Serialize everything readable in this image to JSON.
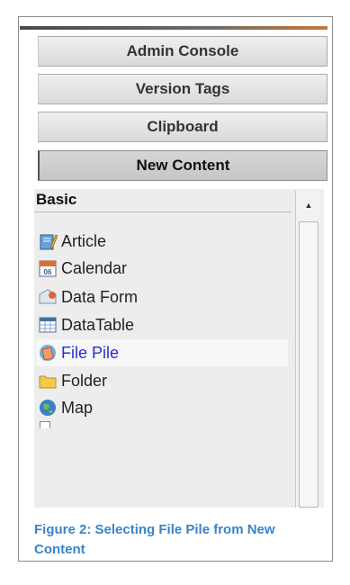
{
  "tabs": [
    {
      "label": "Admin Console"
    },
    {
      "label": "Version Tags"
    },
    {
      "label": "Clipboard"
    },
    {
      "label": "New Content"
    }
  ],
  "section": {
    "label": "Basic"
  },
  "items": [
    {
      "label": "Article",
      "icon": "article-icon"
    },
    {
      "label": "Calendar",
      "icon": "calendar-icon",
      "icon_text": "06"
    },
    {
      "label": "Data Form",
      "icon": "data-form-icon"
    },
    {
      "label": "DataTable",
      "icon": "datatable-icon"
    },
    {
      "label": "File Pile",
      "icon": "file-pile-icon"
    },
    {
      "label": "Folder",
      "icon": "folder-icon"
    },
    {
      "label": "Map",
      "icon": "map-icon"
    }
  ],
  "selected_item": "File Pile",
  "caption": {
    "text": "Figure 2: Selecting File Pile from New Content"
  },
  "colors": {
    "caption": "#3a83c8",
    "selected_text": "#2b2bd6",
    "topbar_accent": "#c77a3a"
  }
}
